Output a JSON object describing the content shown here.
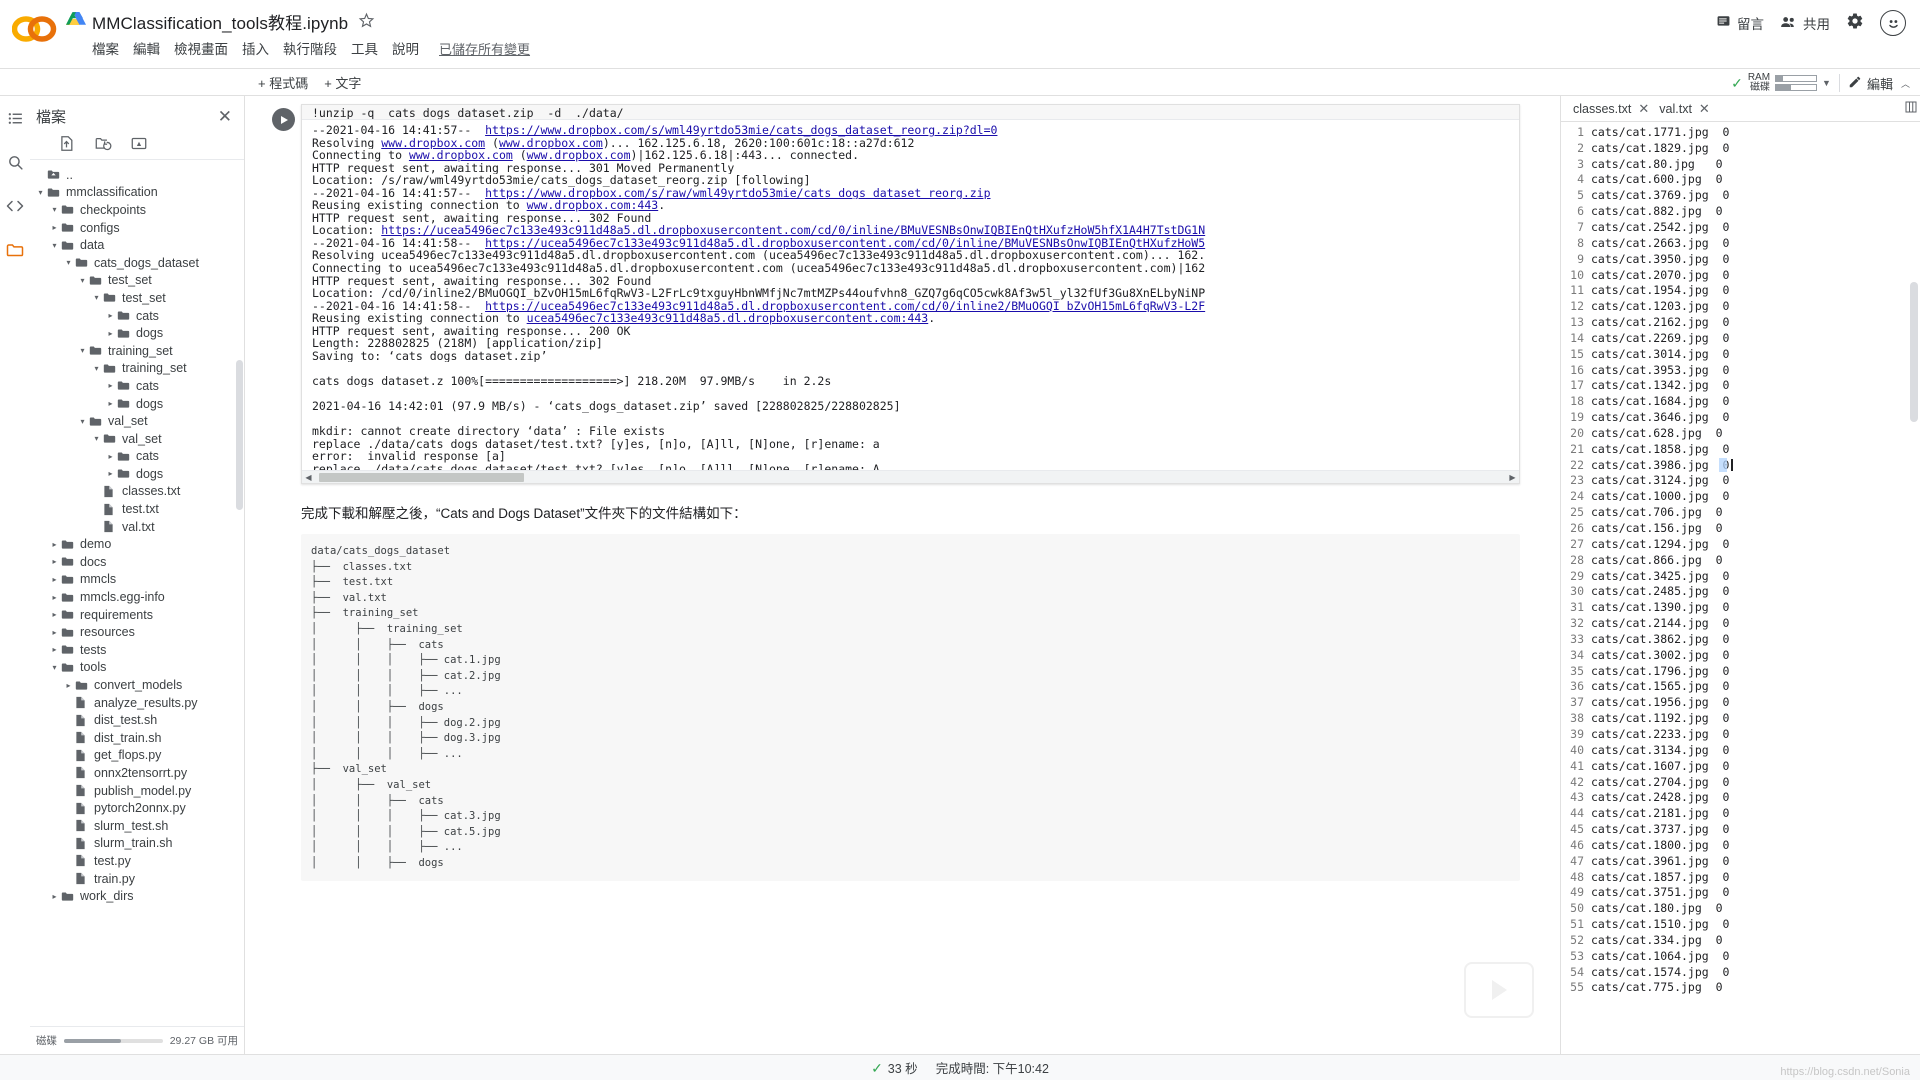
{
  "app": {
    "logo": "colab-logo",
    "doc_title": "MMClassification_tools教程.ipynb",
    "drive_icon": "drive-icon",
    "star_icon": "star-icon"
  },
  "menu": {
    "items": [
      "檔案",
      "編輯",
      "檢視畫面",
      "插入",
      "執行階段",
      "工具",
      "說明"
    ],
    "saved_note": "已儲存所有變更"
  },
  "topbar_right": {
    "comment_label": "留言",
    "comment_icon": "comment-icon",
    "share_label": "共用",
    "share_icon": "people-icon",
    "settings_icon": "gear-icon",
    "avatar_icon": "smiley-avatar"
  },
  "toolbar": {
    "add_code": "+ 程式碼",
    "add_text": "+ 文字",
    "ram_line1": "RAM",
    "ram_line2": "磁碟",
    "ram_fill_pct": 18,
    "disk_fill_pct": 38,
    "check_icon": "check-icon",
    "caret_icon": "chevron-down-icon",
    "edit_label": "編輯",
    "edit_icon": "pencil-icon",
    "collapse_icon": "chevron-up-icon"
  },
  "rail": {
    "items": [
      {
        "name": "toc-icon",
        "glyph": "☰"
      },
      {
        "name": "search-icon",
        "glyph": "search"
      },
      {
        "name": "code-snippets-icon",
        "glyph": "<>"
      },
      {
        "name": "files-icon",
        "glyph": "folder",
        "active": true
      }
    ]
  },
  "files_panel": {
    "title": "檔案",
    "close_icon": "close-icon",
    "tools": [
      "upload-icon",
      "refresh-folder-icon",
      "mount-drive-icon"
    ],
    "tree": [
      {
        "label": "..",
        "depth": 1,
        "type": "up",
        "twisty": "none"
      },
      {
        "label": "mmclassification",
        "depth": 1,
        "type": "folder",
        "twisty": "open"
      },
      {
        "label": "checkpoints",
        "depth": 2,
        "type": "folder",
        "twisty": "open"
      },
      {
        "label": "configs",
        "depth": 2,
        "type": "folder",
        "twisty": "closed"
      },
      {
        "label": "data",
        "depth": 2,
        "type": "folder",
        "twisty": "open"
      },
      {
        "label": "cats_dogs_dataset",
        "depth": 3,
        "type": "folder",
        "twisty": "open"
      },
      {
        "label": "test_set",
        "depth": 4,
        "type": "folder",
        "twisty": "open"
      },
      {
        "label": "test_set",
        "depth": 5,
        "type": "folder",
        "twisty": "open"
      },
      {
        "label": "cats",
        "depth": 6,
        "type": "folder",
        "twisty": "closed"
      },
      {
        "label": "dogs",
        "depth": 6,
        "type": "folder",
        "twisty": "closed"
      },
      {
        "label": "training_set",
        "depth": 4,
        "type": "folder",
        "twisty": "open"
      },
      {
        "label": "training_set",
        "depth": 5,
        "type": "folder",
        "twisty": "open"
      },
      {
        "label": "cats",
        "depth": 6,
        "type": "folder",
        "twisty": "closed"
      },
      {
        "label": "dogs",
        "depth": 6,
        "type": "folder",
        "twisty": "closed"
      },
      {
        "label": "val_set",
        "depth": 4,
        "type": "folder",
        "twisty": "open"
      },
      {
        "label": "val_set",
        "depth": 5,
        "type": "folder",
        "twisty": "open"
      },
      {
        "label": "cats",
        "depth": 6,
        "type": "folder",
        "twisty": "closed"
      },
      {
        "label": "dogs",
        "depth": 6,
        "type": "folder",
        "twisty": "closed"
      },
      {
        "label": "classes.txt",
        "depth": 5,
        "type": "file",
        "twisty": "none"
      },
      {
        "label": "test.txt",
        "depth": 5,
        "type": "file",
        "twisty": "none"
      },
      {
        "label": "val.txt",
        "depth": 5,
        "type": "file",
        "twisty": "none"
      },
      {
        "label": "demo",
        "depth": 2,
        "type": "folder",
        "twisty": "closed"
      },
      {
        "label": "docs",
        "depth": 2,
        "type": "folder",
        "twisty": "closed"
      },
      {
        "label": "mmcls",
        "depth": 2,
        "type": "folder",
        "twisty": "closed"
      },
      {
        "label": "mmcls.egg-info",
        "depth": 2,
        "type": "folder",
        "twisty": "closed"
      },
      {
        "label": "requirements",
        "depth": 2,
        "type": "folder",
        "twisty": "closed"
      },
      {
        "label": "resources",
        "depth": 2,
        "type": "folder",
        "twisty": "closed"
      },
      {
        "label": "tests",
        "depth": 2,
        "type": "folder",
        "twisty": "closed"
      },
      {
        "label": "tools",
        "depth": 2,
        "type": "folder",
        "twisty": "open"
      },
      {
        "label": "convert_models",
        "depth": 3,
        "type": "folder",
        "twisty": "closed"
      },
      {
        "label": "analyze_results.py",
        "depth": 3,
        "type": "file",
        "twisty": "none"
      },
      {
        "label": "dist_test.sh",
        "depth": 3,
        "type": "file",
        "twisty": "none"
      },
      {
        "label": "dist_train.sh",
        "depth": 3,
        "type": "file",
        "twisty": "none"
      },
      {
        "label": "get_flops.py",
        "depth": 3,
        "type": "file",
        "twisty": "none"
      },
      {
        "label": "onnx2tensorrt.py",
        "depth": 3,
        "type": "file",
        "twisty": "none"
      },
      {
        "label": "publish_model.py",
        "depth": 3,
        "type": "file",
        "twisty": "none"
      },
      {
        "label": "pytorch2onnx.py",
        "depth": 3,
        "type": "file",
        "twisty": "none"
      },
      {
        "label": "slurm_test.sh",
        "depth": 3,
        "type": "file",
        "twisty": "none"
      },
      {
        "label": "slurm_train.sh",
        "depth": 3,
        "type": "file",
        "twisty": "none"
      },
      {
        "label": "test.py",
        "depth": 3,
        "type": "file",
        "twisty": "none"
      },
      {
        "label": "train.py",
        "depth": 3,
        "type": "file",
        "twisty": "none"
      },
      {
        "label": "work_dirs",
        "depth": 2,
        "type": "folder",
        "twisty": "closed"
      }
    ],
    "disk_label": "磁碟",
    "disk_free": "29.27 GB 可用",
    "disk_fill_pct": 58
  },
  "notebook": {
    "code_line": "!unzip -q  cats_dogs_dataset.zip  -d  ./data/",
    "run_icon": "run-cell-icon",
    "output_lines": [
      {
        "text": "--2021-04-16 14:41:57--  ",
        "link": "https://www.dropbox.com/s/wml49yrtdo53mie/cats_dogs_dataset_reorg.zip?dl=0"
      },
      {
        "text": "Resolving www.dropbox.com (www.dropbox.com)... 162.125.6.18, 2620:100:601c:18::a27d:612",
        "linkparts": [
          "www.dropbox.com",
          "www.dropbox.com"
        ]
      },
      {
        "text": "Connecting to www.dropbox.com (www.dropbox.com)|162.125.6.18|:443... connected.",
        "linkparts": [
          "www.dropbox.com",
          "www.dropbox.com"
        ]
      },
      {
        "text": "HTTP request sent, awaiting response... 301 Moved Permanently"
      },
      {
        "text": "Location: /s/raw/wml49yrtdo53mie/cats_dogs_dataset_reorg.zip [following]"
      },
      {
        "text": "--2021-04-16 14:41:57--  ",
        "link": "https://www.dropbox.com/s/raw/wml49yrtdo53mie/cats_dogs_dataset_reorg.zip"
      },
      {
        "text": "Reusing existing connection to www.dropbox.com:443.",
        "linkparts": [
          "www.dropbox.com:443"
        ]
      },
      {
        "text": "HTTP request sent, awaiting response... 302 Found"
      },
      {
        "text": "Location: ",
        "link": "https://ucea5496ec7c133e493c911d48a5.dl.dropboxusercontent.com/cd/0/inline/BMuVESNBsOnwIQBIEnQtHXufzHoW5hfX1A4H7TstDG1N"
      },
      {
        "text": "--2021-04-16 14:41:58--  ",
        "link": "https://ucea5496ec7c133e493c911d48a5.dl.dropboxusercontent.com/cd/0/inline/BMuVESNBsOnwIQBIEnQtHXufzHoW5"
      },
      {
        "text": "Resolving ucea5496ec7c133e493c911d48a5.dl.dropboxusercontent.com (ucea5496ec7c133e493c911d48a5.dl.dropboxusercontent.com)... 162."
      },
      {
        "text": "Connecting to ucea5496ec7c133e493c911d48a5.dl.dropboxusercontent.com (ucea5496ec7c133e493c911d48a5.dl.dropboxusercontent.com)|162"
      },
      {
        "text": "HTTP request sent, awaiting response... 302 Found"
      },
      {
        "text": "Location: /cd/0/inline2/BMuOGQI_bZvOH15mL6fqRwV3-L2FrLc9txguyHbnWMfjNc7mtMZPs44oufvhn8_GZQ7g6qCO5cwk8Af3w5l_yl32fUf3Gu8XnELbyNiNP"
      },
      {
        "text": "--2021-04-16 14:41:58--  ",
        "link": "https://ucea5496ec7c133e493c911d48a5.dl.dropboxusercontent.com/cd/0/inline2/BMuOGQI_bZvOH15mL6fqRwV3-L2F"
      },
      {
        "text": "Reusing existing connection to ucea5496ec7c133e493c911d48a5.dl.dropboxusercontent.com:443.",
        "linkparts": [
          "ucea5496ec7c133e493c911d48a5.dl.dropboxusercontent.com:443"
        ]
      },
      {
        "text": "HTTP request sent, awaiting response... 200 OK"
      },
      {
        "text": "Length: 228802825 (218M) [application/zip]"
      },
      {
        "text": "Saving to: ‘cats_dogs_dataset.zip’"
      },
      {
        "text": ""
      },
      {
        "text": "cats_dogs_dataset.z 100%[===================>] 218.20M  97.9MB/s    in 2.2s"
      },
      {
        "text": ""
      },
      {
        "text": "2021-04-16 14:42:01 (97.9 MB/s) - ‘cats_dogs_dataset.zip’ saved [228802825/228802825]"
      },
      {
        "text": ""
      },
      {
        "text": "mkdir: cannot create directory ‘data’ : File exists"
      },
      {
        "text": "replace ./data/cats_dogs_dataset/test.txt? [y]es, [n]o, [A]ll, [N]one, [r]ename: a"
      },
      {
        "text": "error:  invalid response [a]"
      },
      {
        "text": "replace ./data/cats_dogs_dataset/test.txt? [y]es, [n]o, [A]ll, [N]one, [r]ename: A"
      }
    ],
    "markdown_text": "完成下載和解壓之後，“Cats and Dogs Dataset”文件夾下的文件結構如下：",
    "tree_lines": [
      "data/cats_dogs_dataset",
      "├──  classes.txt",
      "├──  test.txt",
      "├──  val.txt",
      "├──  training_set",
      "│      ├──  training_set",
      "│      │    ├──  cats",
      "│      │    │    ├── cat.1.jpg",
      "│      │    │    ├── cat.2.jpg",
      "│      │    │    ├── ...",
      "│      │    ├──  dogs",
      "│      │    │    ├── dog.2.jpg",
      "│      │    │    ├── dog.3.jpg",
      "│      │    │    ├── ...",
      "├──  val_set",
      "│      ├──  val_set",
      "│      │    ├──  cats",
      "│      │    │    ├── cat.3.jpg",
      "│      │    │    ├── cat.5.jpg",
      "│      │    │    ├── ...",
      "│      │    ├──  dogs"
    ]
  },
  "editor": {
    "tabs": [
      {
        "label": "classes.txt",
        "close_icon": "close-icon",
        "active": false
      },
      {
        "label": "val.txt",
        "close_icon": "close-icon",
        "active": true
      }
    ],
    "grid_icon": "layout-grid-icon",
    "lines": [
      "cats/cat.1771.jpg  0",
      "cats/cat.1829.jpg  0",
      "cats/cat.80.jpg   0",
      "cats/cat.600.jpg  0",
      "cats/cat.3769.jpg  0",
      "cats/cat.882.jpg  0",
      "cats/cat.2542.jpg  0",
      "cats/cat.2663.jpg  0",
      "cats/cat.3950.jpg  0",
      "cats/cat.2070.jpg  0",
      "cats/cat.1954.jpg  0",
      "cats/cat.1203.jpg  0",
      "cats/cat.2162.jpg  0",
      "cats/cat.2269.jpg  0",
      "cats/cat.3014.jpg  0",
      "cats/cat.3953.jpg  0",
      "cats/cat.1342.jpg  0",
      "cats/cat.1684.jpg  0",
      "cats/cat.3646.jpg  0",
      "cats/cat.628.jpg  0",
      "cats/cat.1858.jpg  0",
      "cats/cat.3986.jpg  0",
      "cats/cat.3124.jpg  0",
      "cats/cat.1000.jpg  0",
      "cats/cat.706.jpg  0",
      "cats/cat.156.jpg  0",
      "cats/cat.1294.jpg  0",
      "cats/cat.866.jpg  0",
      "cats/cat.3425.jpg  0",
      "cats/cat.2485.jpg  0",
      "cats/cat.1390.jpg  0",
      "cats/cat.2144.jpg  0",
      "cats/cat.3862.jpg  0",
      "cats/cat.3002.jpg  0",
      "cats/cat.1796.jpg  0",
      "cats/cat.1565.jpg  0",
      "cats/cat.1956.jpg  0",
      "cats/cat.1192.jpg  0",
      "cats/cat.2233.jpg  0",
      "cats/cat.3134.jpg  0",
      "cats/cat.1607.jpg  0",
      "cats/cat.2704.jpg  0",
      "cats/cat.2428.jpg  0",
      "cats/cat.2181.jpg  0",
      "cats/cat.3737.jpg  0",
      "cats/cat.1800.jpg  0",
      "cats/cat.3961.jpg  0",
      "cats/cat.1857.jpg  0",
      "cats/cat.3751.jpg  0",
      "cats/cat.180.jpg  0",
      "cats/cat.1510.jpg  0",
      "cats/cat.334.jpg  0",
      "cats/cat.1064.jpg  0",
      "cats/cat.1574.jpg  0",
      "cats/cat.775.jpg  0"
    ]
  },
  "statusbar": {
    "duration": "33 秒",
    "completed": "完成時間: 下午10:42",
    "check_icon": "check-icon",
    "watermark": "https://blog.csdn.net/Sonia"
  }
}
